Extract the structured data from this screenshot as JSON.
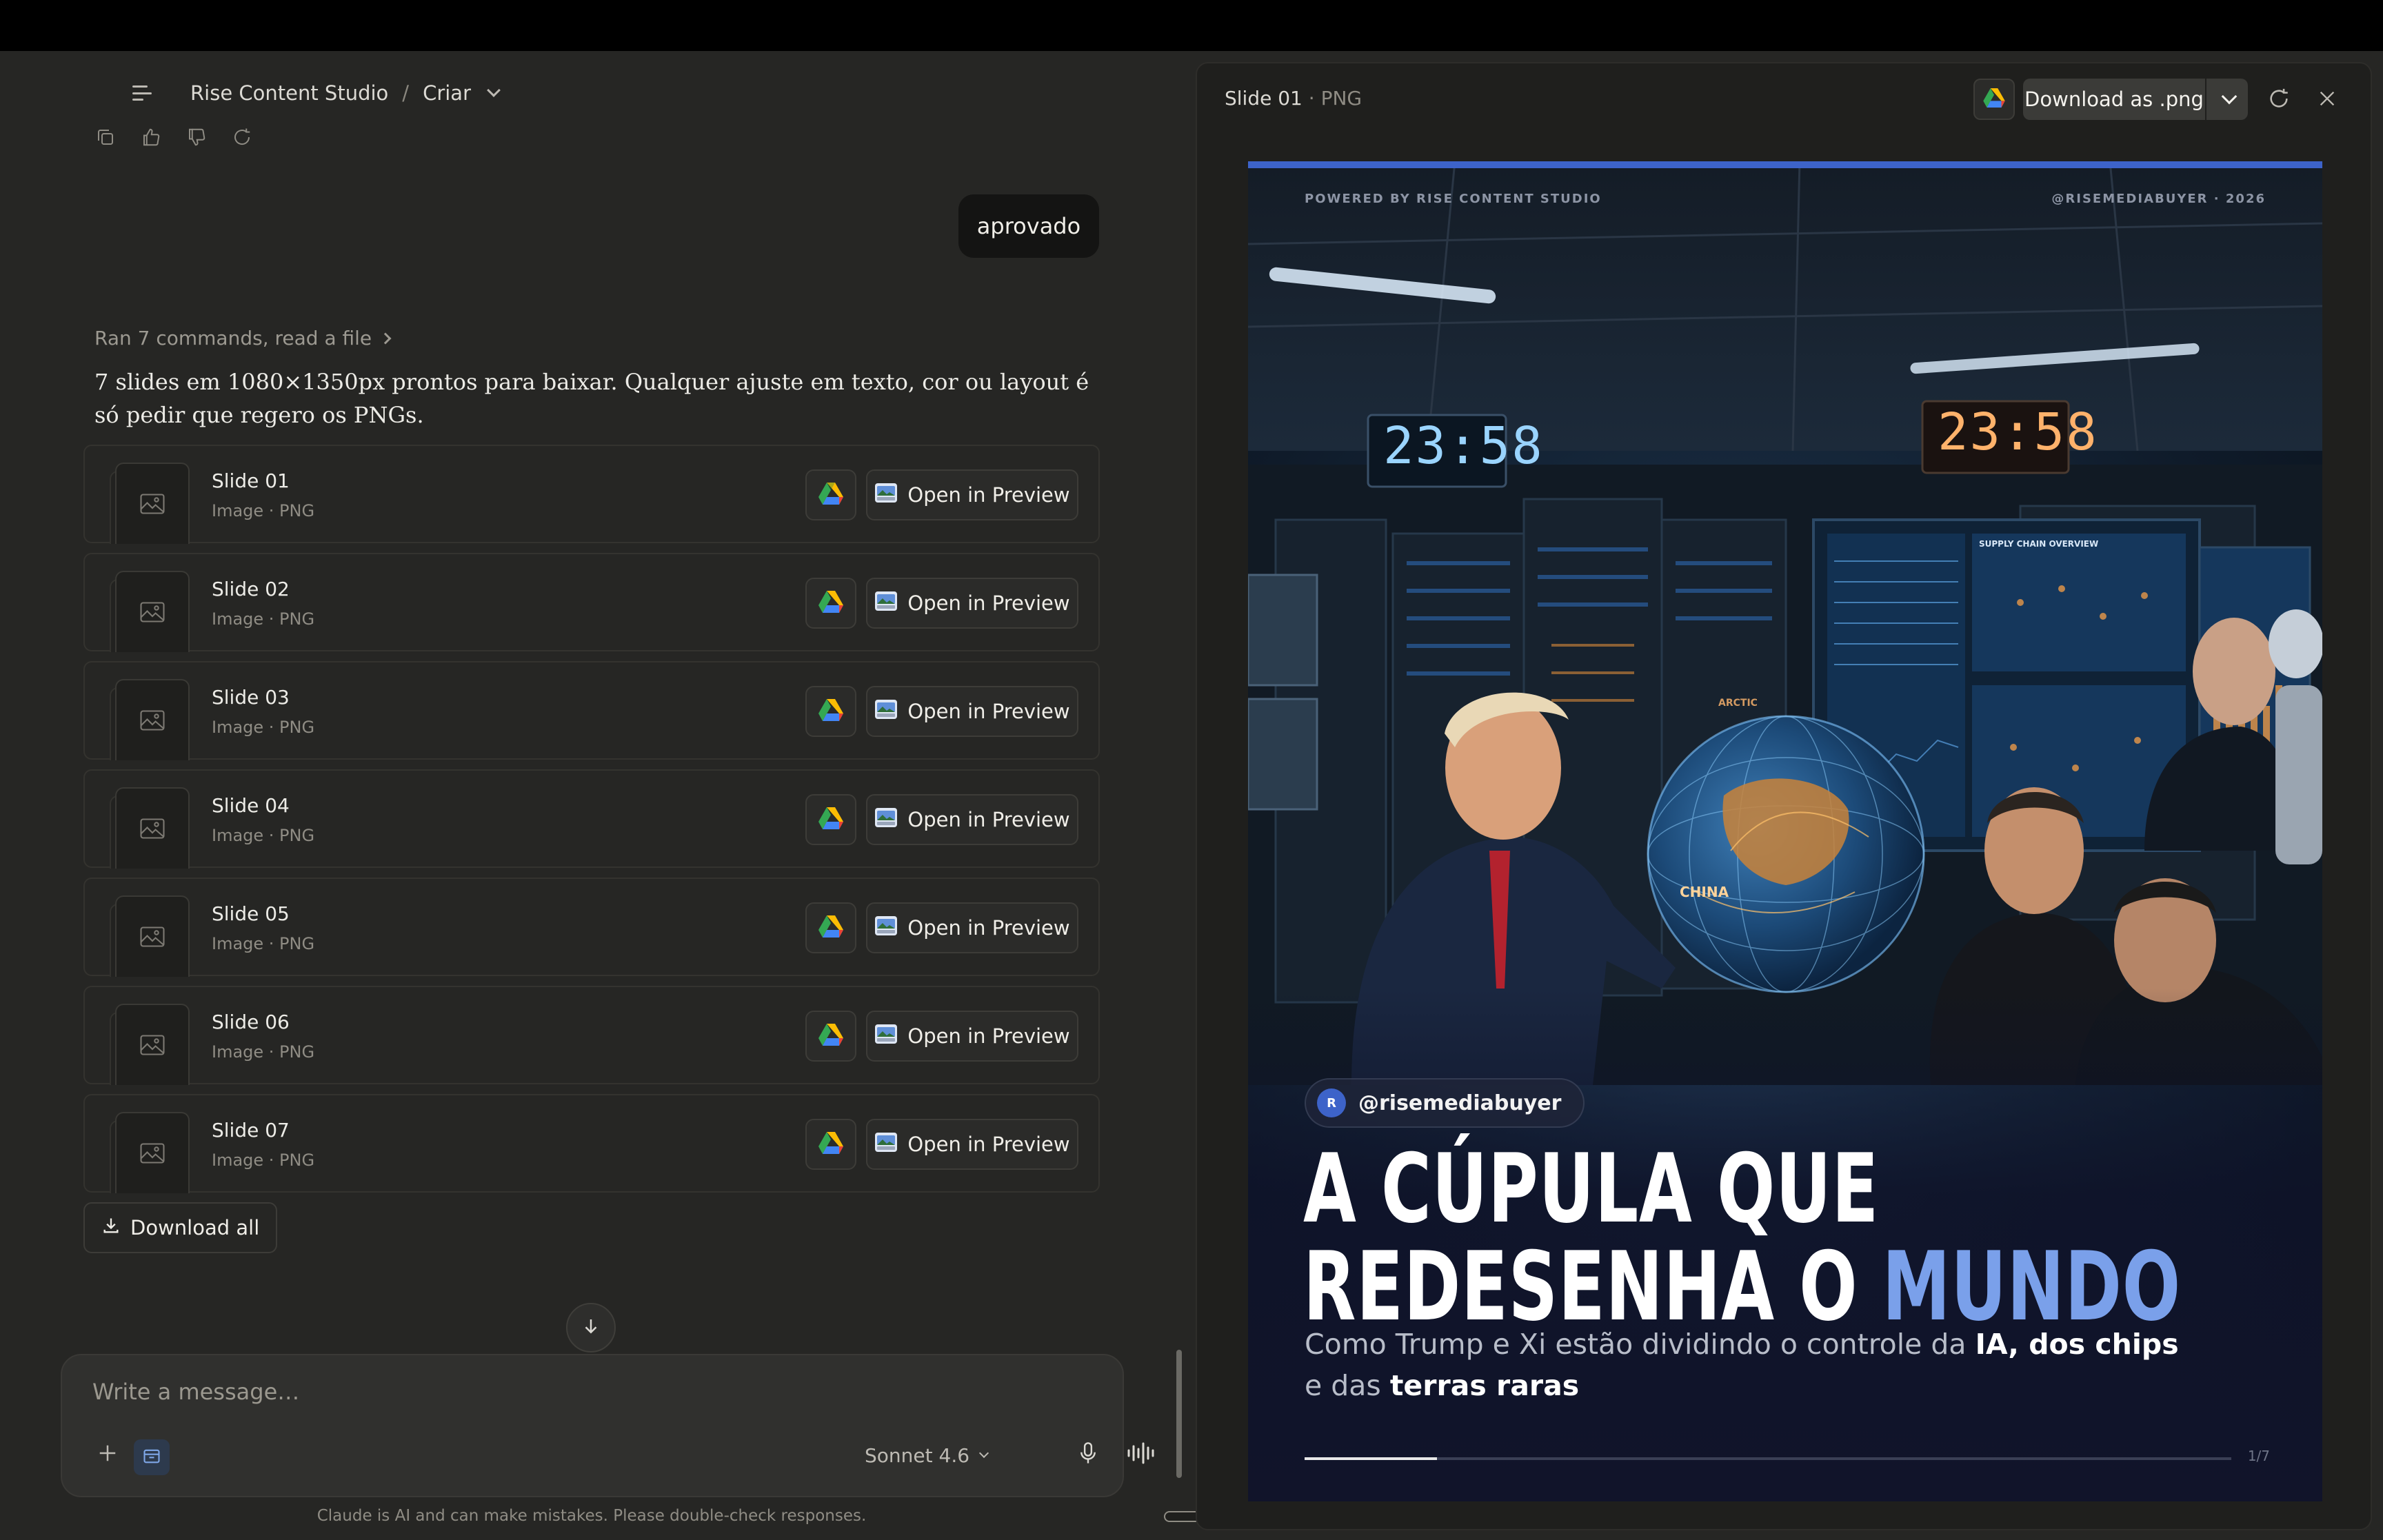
{
  "breadcrumb": {
    "project": "Rise Content Studio",
    "separator": "/",
    "chat": "Criar"
  },
  "user_message": "aprovado",
  "assistant": {
    "tool_summary": "Ran 7 commands, read a file",
    "text": "7 slides em 1080×1350px prontos para baixar. Qualquer ajuste em texto, cor ou layout é só pedir que regero os PNGs."
  },
  "files": [
    {
      "name": "Slide 01",
      "type": "Image · PNG",
      "open_label": "Open in Preview"
    },
    {
      "name": "Slide 02",
      "type": "Image · PNG",
      "open_label": "Open in Preview"
    },
    {
      "name": "Slide 03",
      "type": "Image · PNG",
      "open_label": "Open in Preview"
    },
    {
      "name": "Slide 04",
      "type": "Image · PNG",
      "open_label": "Open in Preview"
    },
    {
      "name": "Slide 05",
      "type": "Image · PNG",
      "open_label": "Open in Preview"
    },
    {
      "name": "Slide 06",
      "type": "Image · PNG",
      "open_label": "Open in Preview"
    },
    {
      "name": "Slide 07",
      "type": "Image · PNG",
      "open_label": "Open in Preview"
    }
  ],
  "download_all_label": "Download all",
  "composer": {
    "placeholder": "Write a message…",
    "model": "Sonnet 4.6"
  },
  "disclaimer": "Claude is AI and can make mistakes. Please double-check responses.",
  "preview": {
    "title": "Slide 01",
    "meta": "· PNG",
    "download_label": "Download as .png",
    "slide": {
      "powered_by": "POWERED BY RISE CONTENT STUDIO",
      "handle_year": "@RISEMEDIABUYER · 2026",
      "clock_left": "23:58",
      "clock_right": "23:58",
      "map_label_china": "CHINA",
      "map_label_arctic": "ARCTIC",
      "panel_label": "SUPPLY CHAIN OVERVIEW",
      "author_initial": "R",
      "author_handle": "@risemediabuyer",
      "headline_line1": "A CÚPULA QUE",
      "headline_line2_a": "REDESENHA O ",
      "headline_line2_b": "MUNDO",
      "sub_a": "Como Trump e Xi estão dividindo o controle da ",
      "sub_b1": "IA, dos chips",
      "sub_c": " e das ",
      "sub_b2": "terras raras",
      "page_indicator": "1/7",
      "progress": 0.143
    }
  },
  "colors": {
    "accent_blue": "#3d63c9",
    "headline_accent": "#7aa0ea",
    "clock_blue": "#9ad4ff",
    "clock_orange": "#ffb26b"
  }
}
